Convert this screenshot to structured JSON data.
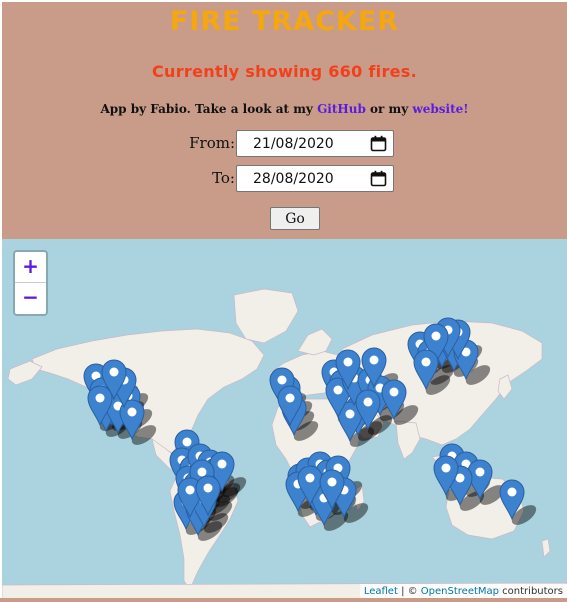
{
  "app": {
    "title": "FIRE TRACKER",
    "subtitle": "Currently showing 660 fires.",
    "credits_prefix": "App by Fabio. Take a look at my ",
    "credits_github": "GitHub",
    "credits_middle": " or my ",
    "credits_website": "website!"
  },
  "form": {
    "from_label": "From:",
    "from_value": "21/08/2020",
    "to_label": "To:",
    "to_value": "28/08/2020",
    "go_label": "Go"
  },
  "map": {
    "zoom_in": "+",
    "zoom_out": "−",
    "attribution_leaflet": "Leaflet",
    "attribution_sep": " | © ",
    "attribution_osm": "OpenStreetMap",
    "attribution_suffix": " contributors"
  },
  "colors": {
    "header_bg": "#c99b89",
    "title": "#f4a70e",
    "subtitle": "#f0401c",
    "link": "#5a1bdf",
    "ocean": "#aad3df",
    "land": "#f2efe9",
    "marker": "#3d82cf"
  }
}
